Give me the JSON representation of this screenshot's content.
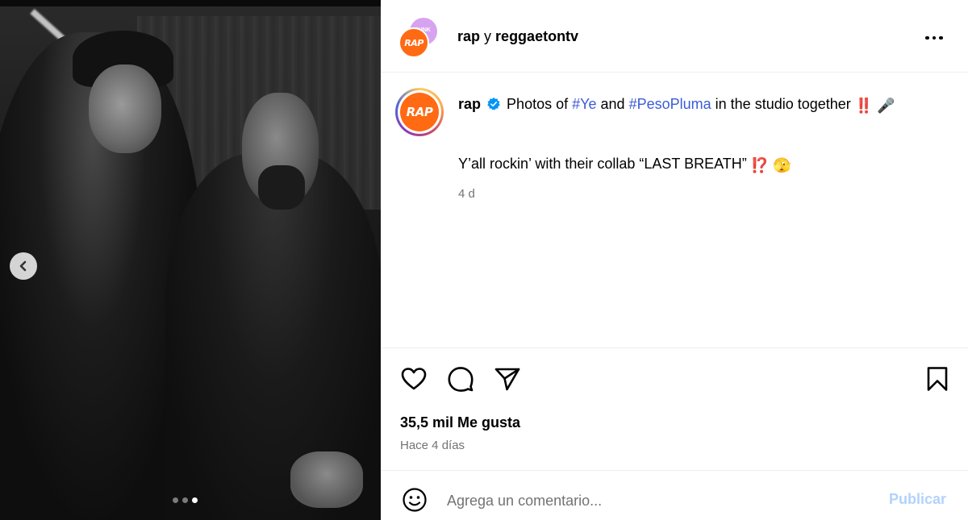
{
  "carousel": {
    "prev_icon": "chevron-left-icon",
    "dots": [
      false,
      false,
      true
    ]
  },
  "header": {
    "avatar_back_text": "SUNK",
    "logo_text": "RAP",
    "username1": "rap",
    "conjunction": "y",
    "username2": "reggaetontv",
    "more_icon": "more-horizontal-icon"
  },
  "caption": {
    "username": "rap",
    "verified_icon": "verified-badge-icon",
    "text_before": "Photos of",
    "hashtag1": "#Ye",
    "text_mid": "and",
    "hashtag2": "#PesoPluma",
    "text_after": "in the studio together",
    "emoji_exclaim": "‼️",
    "emoji_mic": "🎤",
    "line2": "Y’all rockin’ with their collab “LAST BREATH”",
    "emoji_interrobang": "⁉️",
    "emoji_peek": "🫣",
    "time": "4 d"
  },
  "actions": {
    "like_icon": "heart-icon",
    "comment_icon": "comment-icon",
    "share_icon": "send-icon",
    "save_icon": "bookmark-icon"
  },
  "stats": {
    "likes": "35,5 mil Me gusta",
    "ago": "Hace 4 días"
  },
  "comment": {
    "emoji_icon": "smiley-icon",
    "placeholder": "Agrega un comentario...",
    "publish_label": "Publicar"
  },
  "colors": {
    "brand_orange": "#ff6a13",
    "hashtag_blue": "#3b5cd6",
    "publish_disabled": "#b3d2fc",
    "muted": "#737373"
  }
}
